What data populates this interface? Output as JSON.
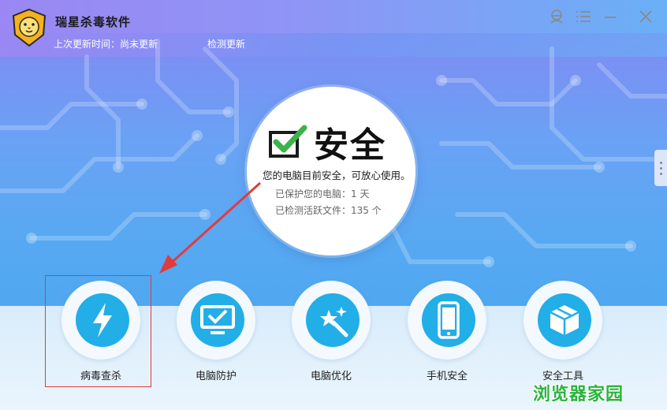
{
  "app": {
    "title": "瑞星杀毒软件",
    "update_status": "上次更新时间：尚未更新",
    "check_update_label": "检测更新"
  },
  "status": {
    "headline": "安全",
    "description": "您的电脑目前安全，可放心使用。",
    "protected_days": "已保护您的电脑：1 天",
    "files_checked": "已检测活跃文件：135 个"
  },
  "tools": [
    {
      "label": "病毒查杀",
      "icon": "lightning-icon"
    },
    {
      "label": "电脑防护",
      "icon": "monitor-shield-icon"
    },
    {
      "label": "电脑优化",
      "icon": "magic-wand-icon"
    },
    {
      "label": "手机安全",
      "icon": "phone-icon"
    },
    {
      "label": "安全工具",
      "icon": "box-icon"
    }
  ],
  "watermark": "浏览器家园",
  "colors": {
    "accent": "#22aee7",
    "check_green": "#3db24a",
    "highlight_red": "#e23b3b",
    "watermark_green": "#2ab43c"
  }
}
